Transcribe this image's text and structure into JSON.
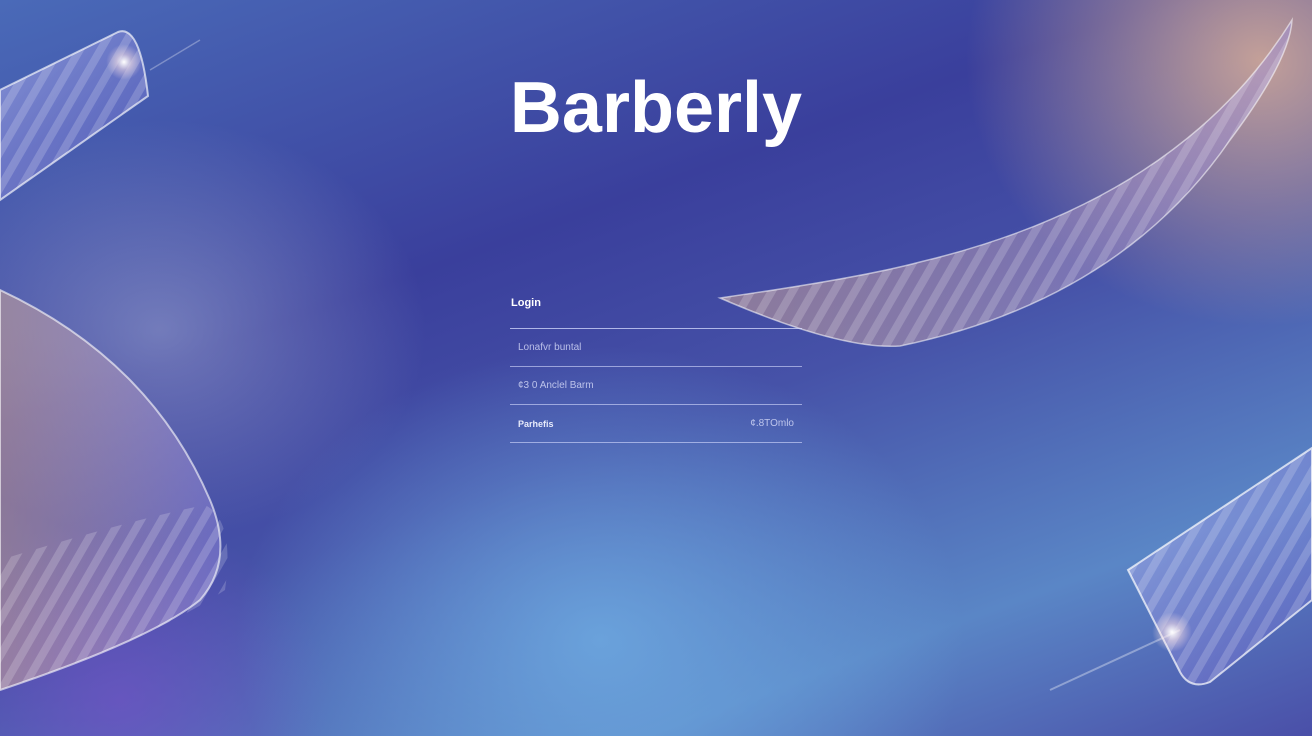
{
  "app": {
    "brand": "Barberly"
  },
  "login": {
    "title": "Login",
    "field_1": "Lonafvr buntal",
    "field_2": "¢3 0 Anclel Barm",
    "field_3_left": "Parhefis",
    "field_3_right": "¢.8TOmlo"
  },
  "colors": {
    "background_primary": "#3a3f9c",
    "background_light": "#5a86c6",
    "accent_warm": "#f0be96",
    "text": "#ffffff"
  }
}
